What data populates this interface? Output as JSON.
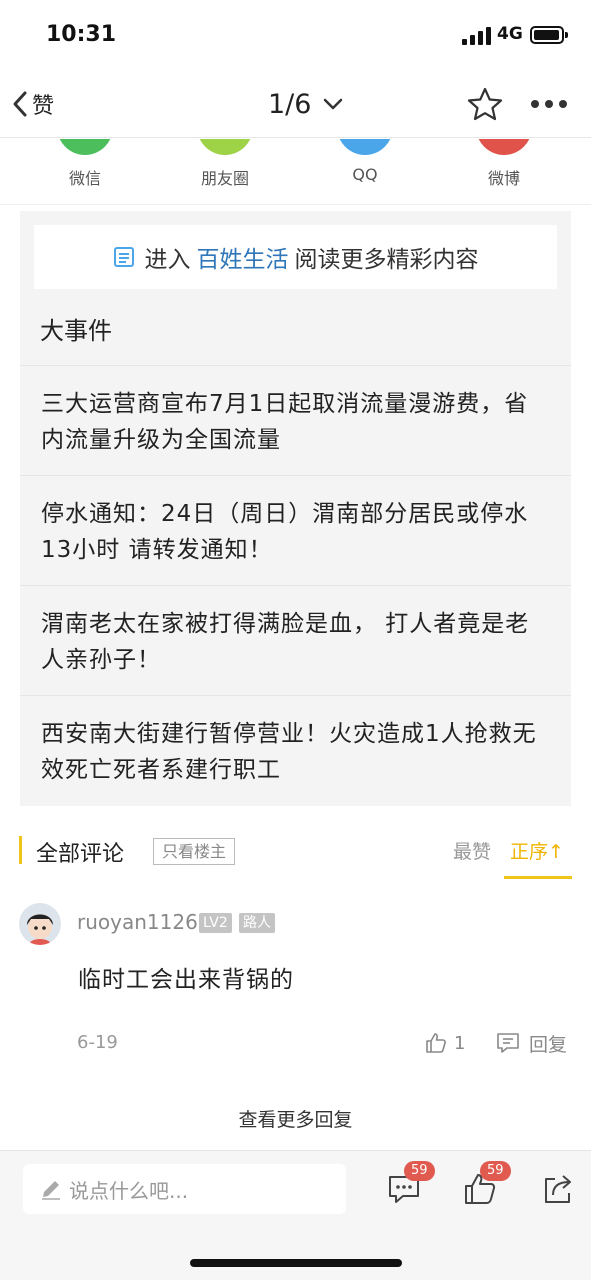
{
  "status_bar": {
    "time": "10:31",
    "network": "4G"
  },
  "nav": {
    "back_label": "赞",
    "pager": "1/6"
  },
  "share": {
    "items": [
      {
        "label": "微信",
        "color": "#4cbf5c"
      },
      {
        "label": "朋友圈",
        "color": "#9fd347"
      },
      {
        "label": "QQ",
        "color": "#4aa6e8"
      },
      {
        "label": "微博",
        "color": "#e0534a"
      }
    ]
  },
  "related": {
    "enter_prefix": "进入",
    "enter_app": "百姓生活",
    "enter_suffix": "阅读更多精彩内容",
    "heading": "大事件",
    "news": [
      {
        "title": "三大运营商宣布7月1日起取消流量漫游费，省内流量升级为全国流量"
      },
      {
        "title": "停水通知：24日（周日）渭南部分居民或停水13小时 请转发通知！"
      },
      {
        "title": "渭南老太在家被打得满脸是血， 打人者竟是老人亲孙子！"
      },
      {
        "title": "西安南大街建行暂停营业！火灾造成1人抢救无效死亡死者系建行职工"
      }
    ]
  },
  "comments_header": {
    "title": "全部评论",
    "only_op": "只看楼主",
    "sort_hot": "最赞",
    "sort_order": "正序↑"
  },
  "comment": {
    "username": "ruoyan1126",
    "level": "LV2",
    "rank": "路人",
    "text": "临时工会出来背锅的",
    "date": "6-19",
    "likes": "1",
    "reply_label": "回复"
  },
  "view_more": "查看更多回复",
  "bottom_bar": {
    "input_placeholder": "说点什么吧...",
    "comment_count": "59",
    "like_count": "59"
  }
}
